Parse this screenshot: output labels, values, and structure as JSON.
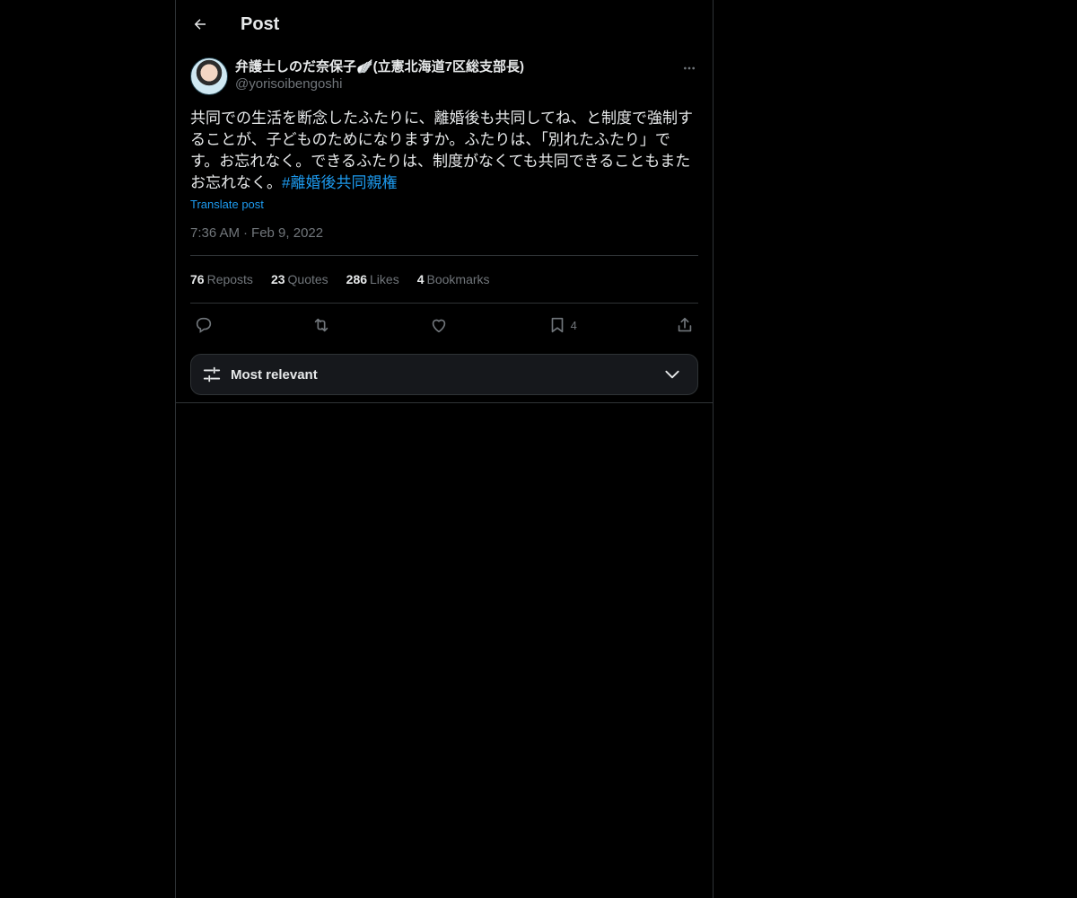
{
  "header": {
    "title": "Post"
  },
  "post": {
    "display_name": "弁護士しのだ奈保子🪽(立憲北海道7区総支部長)",
    "handle": "@yorisoibengoshi",
    "text": "共同での生活を断念したふたりに、離婚後も共同してね、と制度で強制することが、子どものためになりますか。ふたりは、「別れたふたり」です。お忘れなく。できるふたりは、制度がなくても共同できることもまたお忘れなく。",
    "hashtag": "#離婚後共同親権",
    "translate_label": "Translate post",
    "time": "7:36 AM",
    "date": "Feb 9, 2022"
  },
  "stats": {
    "reposts_count": "76",
    "reposts_label": "Reposts",
    "quotes_count": "23",
    "quotes_label": "Quotes",
    "likes_count": "286",
    "likes_label": "Likes",
    "bookmarks_count": "4",
    "bookmarks_label": "Bookmarks"
  },
  "actions": {
    "reply_icon": "reply-icon",
    "repost_icon": "repost-icon",
    "like_icon": "heart-icon",
    "bookmark_icon": "bookmark-icon",
    "bookmark_count": "4",
    "share_icon": "share-icon"
  },
  "sort": {
    "label": "Most relevant"
  },
  "colors": {
    "background": "#000000",
    "text": "#e7e9ea",
    "muted": "#71767b",
    "accent": "#1d9bf0",
    "border": "#2f3336"
  }
}
